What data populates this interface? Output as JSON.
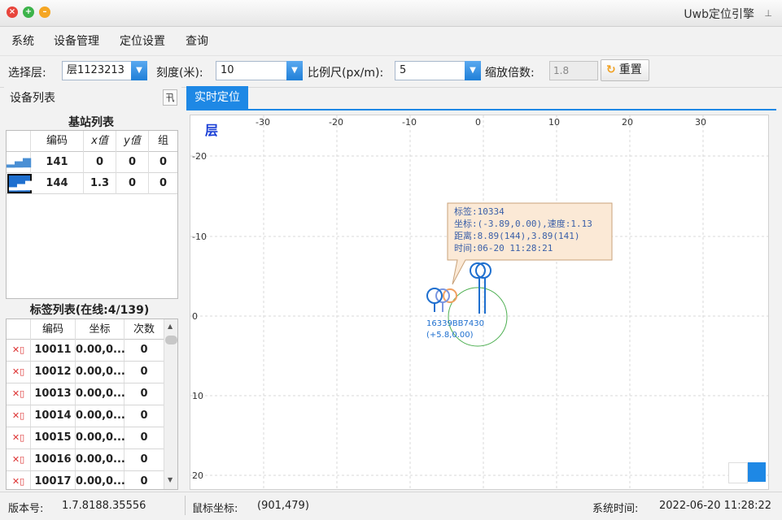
{
  "window": {
    "title": "Uwb定位引擎"
  },
  "menu": [
    "系统",
    "设备管理",
    "定位设置",
    "查询"
  ],
  "toolbar": {
    "floor_label": "选择层:",
    "floor_value": "层1123213",
    "scale_label": "刻度(米):",
    "scale_value": "10",
    "ratio_label": "比例尺(px/m):",
    "ratio_value": "5",
    "zoom_label": "缩放倍数:",
    "zoom_value": "1.8",
    "reset_label": "重置"
  },
  "left_panel": {
    "title": "设备列表",
    "pin": "卂",
    "anchors": {
      "title": "基站列表",
      "headers": [
        "编码",
        "x值",
        "y值",
        "组"
      ],
      "rows": [
        {
          "code": "141",
          "x": "0",
          "y": "0",
          "group": "0"
        },
        {
          "code": "144",
          "x": "1.3",
          "y": "0",
          "group": "0"
        }
      ]
    },
    "tags": {
      "title": "标签列表(在线:4/139)",
      "headers": [
        "编码",
        "坐标",
        "次数"
      ],
      "rows": [
        {
          "code": "10011",
          "coord": "0.00,0...",
          "count": "0"
        },
        {
          "code": "10012",
          "coord": "0.00,0...",
          "count": "0"
        },
        {
          "code": "10013",
          "coord": "0.00,0...",
          "count": "0"
        },
        {
          "code": "10014",
          "coord": "0.00,0...",
          "count": "0"
        },
        {
          "code": "10015",
          "coord": "0.00,0...",
          "count": "0"
        },
        {
          "code": "10016",
          "coord": "0.00,0...",
          "count": "0"
        },
        {
          "code": "10017",
          "coord": "0.00,0...",
          "count": "0"
        }
      ]
    }
  },
  "tab": {
    "label": "实时定位"
  },
  "map": {
    "floor_glyph": "层",
    "x_ticks": [
      "-30",
      "-20",
      "-10",
      "0",
      "10",
      "20",
      "30"
    ],
    "y_ticks": [
      "-20",
      "-10",
      "0",
      "10",
      "20"
    ],
    "marker_label_line1": "16339BB7430",
    "marker_label_line2": "(+5.8,0.00)",
    "tooltip": {
      "line1": "标签:10334",
      "line2": "坐标:(-3.89,0.00),速度:1.13",
      "line3": "距离:8.89(144),3.89(141)",
      "line4": "时间:06-20 11:28:21"
    }
  },
  "status": {
    "version_label": "版本号:",
    "version_value": "1.7.8188.35556",
    "mouse_label": "鼠标坐标:",
    "mouse_value": "(901,479)",
    "time_label": "系统时间:",
    "time_value": "2022-06-20 11:28:22"
  },
  "colors": {
    "accent": "#1e88e5",
    "tooltip_bg": "#fbe9d6",
    "circle": "#4caf50"
  }
}
